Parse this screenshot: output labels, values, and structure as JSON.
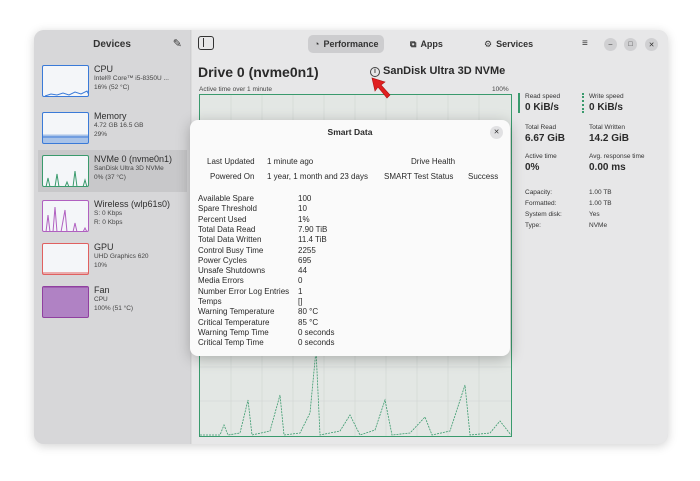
{
  "sidebar": {
    "title": "Devices",
    "items": [
      {
        "name": "CPU",
        "line1": "Intel® Core™ i5-8350U ...",
        "line2": "16% (52 °C)",
        "color": "#3a7ad8"
      },
      {
        "name": "Memory",
        "line1": "4.72 GB 16.5 GB",
        "line2": "29%",
        "color": "#3a7ad8"
      },
      {
        "name": "NVMe 0 (nvme0n1)",
        "line1": "SanDisk Ultra 3D NVMe",
        "line2": "0% (37 °C)",
        "color": "#3a9a6d"
      },
      {
        "name": "Wireless (wlp61s0)",
        "line1": "S: 0 Kbps",
        "line2": "R: 0 Kbps",
        "color": "#b060c0"
      },
      {
        "name": "GPU",
        "line1": "UHD Graphics 620",
        "line2": "10%",
        "color": "#e06060"
      },
      {
        "name": "Fan",
        "line1": "CPU",
        "line2": "100% (51 °C)",
        "color": "#9040a0"
      }
    ]
  },
  "tabs": [
    {
      "label": "Performance",
      "icon": "gauge-icon"
    },
    {
      "label": "Apps",
      "icon": "apps-icon"
    },
    {
      "label": "Services",
      "icon": "gear-icon"
    }
  ],
  "drive": {
    "title": "Drive 0 (nvme0n1)",
    "model": "SanDisk Ultra 3D NVMe",
    "active_label": "Active time over 1 minute",
    "pct_label": "100%"
  },
  "stats": {
    "read_speed_label": "Read speed",
    "read_speed": "0 KiB/s",
    "write_speed_label": "Write speed",
    "write_speed": "0 KiB/s",
    "total_read_label": "Total Read",
    "total_read": "6.67 GiB",
    "total_written_label": "Total Written",
    "total_written": "14.2 GiB",
    "active_time_label": "Active time",
    "active_time": "0%",
    "avg_resp_label": "Avg. response time",
    "avg_resp": "0.00 ms",
    "details": [
      {
        "k": "Capacity:",
        "v": "1.00 TB"
      },
      {
        "k": "Formatted:",
        "v": "1.00 TB"
      },
      {
        "k": "System disk:",
        "v": "Yes"
      },
      {
        "k": "Type:",
        "v": "NVMe"
      }
    ]
  },
  "modal": {
    "title": "Smart Data",
    "last_updated_label": "Last Updated",
    "last_updated": "1 minute ago",
    "drive_health_label": "Drive Health",
    "powered_on_label": "Powered On",
    "powered_on": "1 year, 1 month and 23 days",
    "smart_status_label": "SMART Test Status",
    "smart_status": "Success",
    "rows": [
      {
        "k": "Available Spare",
        "v": "100"
      },
      {
        "k": "Spare Threshold",
        "v": "10"
      },
      {
        "k": "Percent Used",
        "v": "1%"
      },
      {
        "k": "Total Data Read",
        "v": "7.90 TiB"
      },
      {
        "k": "Total Data Written",
        "v": "11.4 TiB"
      },
      {
        "k": "Control Busy Time",
        "v": "2255"
      },
      {
        "k": "Power Cycles",
        "v": "695"
      },
      {
        "k": "Unsafe Shutdowns",
        "v": "44"
      },
      {
        "k": "Media Errors",
        "v": "0"
      },
      {
        "k": "Number Error Log Entries",
        "v": "1"
      },
      {
        "k": "Temps",
        "v": "[]"
      },
      {
        "k": "Warning Temperature",
        "v": "80 °C"
      },
      {
        "k": "Critical Temperature",
        "v": "85 °C"
      },
      {
        "k": "Warning Temp Time",
        "v": "0 seconds"
      },
      {
        "k": "Critical Temp Time",
        "v": "0 seconds"
      }
    ]
  }
}
